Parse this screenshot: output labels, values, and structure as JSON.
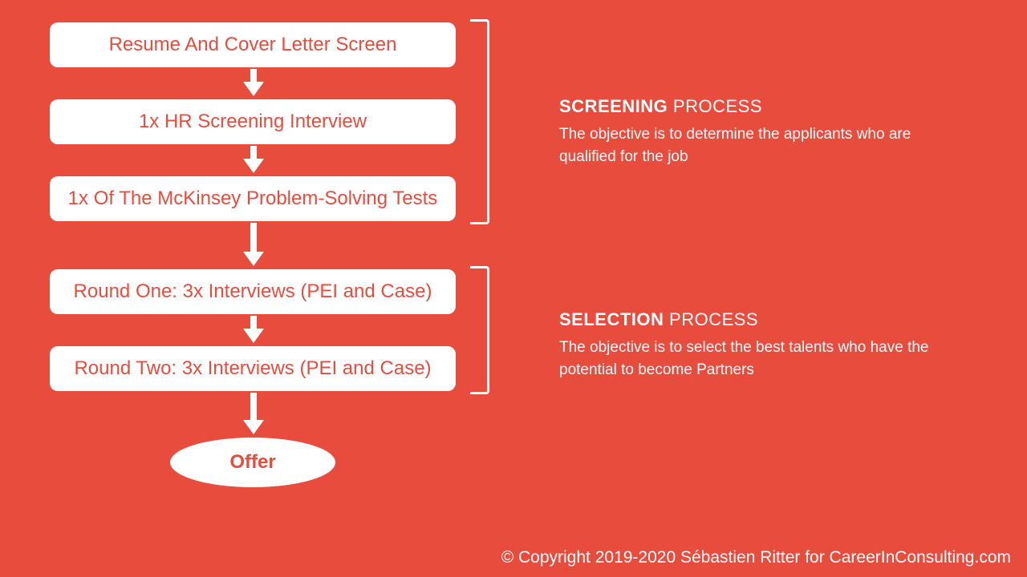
{
  "steps": {
    "s1": "Resume And Cover Letter Screen",
    "s2": "1x HR Screening Interview",
    "s3": "1x Of The McKinsey Problem-Solving Tests",
    "s4": "Round One: 3x Interviews (PEI and Case)",
    "s5": "Round Two: 3x Interviews (PEI and Case)",
    "offer": "Offer"
  },
  "sections": {
    "screening": {
      "title_bold": "SCREENING",
      "title_light": " PROCESS",
      "desc": "The objective is to determine the applicants who are qualified for the job"
    },
    "selection": {
      "title_bold": "SELECTION",
      "title_light": "  PROCESS",
      "desc": "The objective is to select the best talents who have the potential to become Partners"
    }
  },
  "copyright": "© Copyright 2019-2020 Sébastien Ritter for CareerInConsulting.com"
}
